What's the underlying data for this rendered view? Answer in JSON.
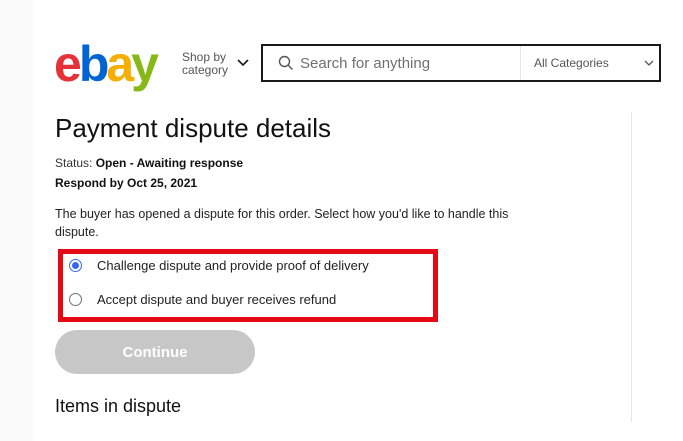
{
  "header": {
    "logo_letters": [
      "e",
      "b",
      "a",
      "y"
    ],
    "logo_colors": [
      "#e53238",
      "#0064d2",
      "#f5af02",
      "#86b817"
    ],
    "shop_by_line1": "Shop by",
    "shop_by_line2": "category",
    "search_placeholder": "Search for anything",
    "category_selected": "All Categories"
  },
  "page": {
    "title": "Payment dispute details",
    "status_label": "Status:",
    "status_value": "Open - Awaiting response",
    "respond_by": "Respond by Oct 25, 2021",
    "description": "The buyer has opened a dispute for this order. Select how you'd like to handle this dispute.",
    "options": [
      {
        "label": "Challenge dispute and provide proof of delivery",
        "selected": true
      },
      {
        "label": "Accept dispute and buyer receives refund",
        "selected": false
      }
    ],
    "continue_label": "Continue",
    "items_heading": "Items in dispute"
  },
  "colors": {
    "accent_blue": "#3665f3",
    "highlight_red": "#e50914",
    "disabled_button": "#c7c7c7"
  }
}
